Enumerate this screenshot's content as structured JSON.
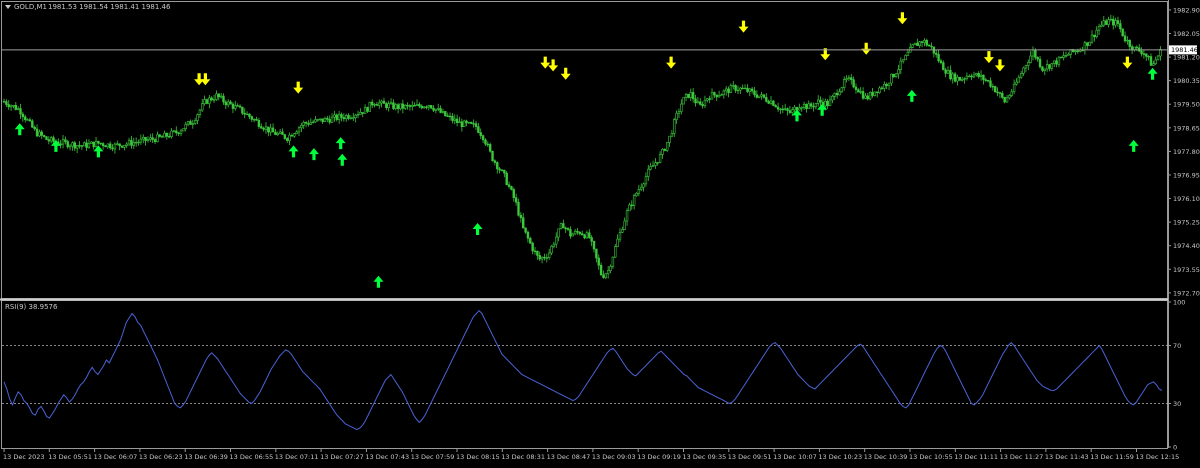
{
  "window": {
    "symbol_title": "GOLD,M1",
    "ohlc_text": "1981.53 1981.54 1981.41 1981.46",
    "current_price_label": "1981.46"
  },
  "colors": {
    "background": "#000000",
    "candles": "#3cc83c",
    "buy_arrow": "#00ff3c",
    "sell_arrow": "#ffff00",
    "rsi_line": "#4a63d6",
    "axis_text": "#c8c8c8",
    "level_line": "#b4b4b4"
  },
  "chart_data": [
    {
      "type": "candlestick",
      "title": "GOLD,M1",
      "y_ticks": [
        "1982.90",
        "1982.05",
        "1981.20",
        "1980.35",
        "1979.50",
        "1978.65",
        "1977.80",
        "1976.95",
        "1976.10",
        "1975.25",
        "1974.40",
        "1973.55",
        "1972.70"
      ],
      "ylim": [
        1972.55,
        1983.15
      ],
      "current_price": 1981.46,
      "series_path": [
        [
          0,
          1979.6
        ],
        [
          10,
          1979.3
        ],
        [
          20,
          1978.5
        ],
        [
          28,
          1978.2
        ],
        [
          38,
          1978.1
        ],
        [
          50,
          1978.0
        ],
        [
          60,
          1978.1
        ],
        [
          70,
          1978.0
        ],
        [
          80,
          1978.1
        ],
        [
          90,
          1978.2
        ],
        [
          100,
          1978.3
        ],
        [
          110,
          1978.5
        ],
        [
          120,
          1978.9
        ],
        [
          128,
          1979.6
        ],
        [
          135,
          1979.8
        ],
        [
          140,
          1979.6
        ],
        [
          150,
          1979.3
        ],
        [
          160,
          1978.9
        ],
        [
          170,
          1978.5
        ],
        [
          180,
          1978.3
        ],
        [
          190,
          1978.8
        ],
        [
          200,
          1978.9
        ],
        [
          210,
          1979.0
        ],
        [
          220,
          1979.1
        ],
        [
          230,
          1979.3
        ],
        [
          235,
          1979.6
        ],
        [
          240,
          1979.5
        ],
        [
          250,
          1979.4
        ],
        [
          260,
          1979.4
        ],
        [
          270,
          1979.5
        ],
        [
          280,
          1979.1
        ],
        [
          290,
          1978.8
        ],
        [
          300,
          1978.7
        ],
        [
          305,
          1978.3
        ],
        [
          310,
          1977.6
        ],
        [
          318,
          1976.9
        ],
        [
          325,
          1976.0
        ],
        [
          330,
          1975.0
        ],
        [
          336,
          1974.3
        ],
        [
          340,
          1973.9
        ],
        [
          346,
          1974.1
        ],
        [
          350,
          1974.6
        ],
        [
          355,
          1975.2
        ],
        [
          360,
          1974.8
        ],
        [
          366,
          1974.9
        ],
        [
          372,
          1974.7
        ],
        [
          376,
          1974.0
        ],
        [
          380,
          1973.3
        ],
        [
          384,
          1973.5
        ],
        [
          390,
          1974.6
        ],
        [
          396,
          1975.6
        ],
        [
          402,
          1976.3
        ],
        [
          410,
          1977.1
        ],
        [
          418,
          1977.7
        ],
        [
          423,
          1978.3
        ],
        [
          427,
          1979.0
        ],
        [
          431,
          1979.6
        ],
        [
          436,
          1979.9
        ],
        [
          442,
          1979.4
        ],
        [
          448,
          1979.8
        ],
        [
          456,
          1979.9
        ],
        [
          464,
          1980.1
        ],
        [
          472,
          1980.0
        ],
        [
          480,
          1979.8
        ],
        [
          488,
          1979.6
        ],
        [
          494,
          1979.3
        ],
        [
          500,
          1979.2
        ],
        [
          506,
          1979.5
        ],
        [
          512,
          1979.4
        ],
        [
          518,
          1979.6
        ],
        [
          524,
          1979.5
        ],
        [
          530,
          1980.0
        ],
        [
          536,
          1980.4
        ],
        [
          542,
          1980.1
        ],
        [
          548,
          1979.7
        ],
        [
          554,
          1980.0
        ],
        [
          560,
          1980.2
        ],
        [
          566,
          1980.6
        ],
        [
          572,
          1981.1
        ],
        [
          578,
          1981.6
        ],
        [
          584,
          1981.8
        ],
        [
          590,
          1981.5
        ],
        [
          596,
          1980.9
        ],
        [
          602,
          1980.5
        ],
        [
          608,
          1980.4
        ],
        [
          614,
          1980.6
        ],
        [
          620,
          1980.5
        ],
        [
          626,
          1980.3
        ],
        [
          632,
          1979.9
        ],
        [
          636,
          1979.6
        ],
        [
          642,
          1980.1
        ],
        [
          648,
          1980.8
        ],
        [
          654,
          1981.4
        ],
        [
          660,
          1980.8
        ],
        [
          668,
          1981.0
        ],
        [
          676,
          1981.3
        ],
        [
          684,
          1981.5
        ],
        [
          690,
          1981.8
        ],
        [
          696,
          1982.3
        ],
        [
          702,
          1982.5
        ],
        [
          708,
          1982.4
        ],
        [
          712,
          1981.9
        ],
        [
          718,
          1981.5
        ],
        [
          724,
          1981.4
        ],
        [
          730,
          1980.9
        ],
        [
          736,
          1981.5
        ]
      ],
      "sell_arrows": [
        [
          124,
          1980.4
        ],
        [
          128,
          1980.4
        ],
        [
          187,
          1980.1
        ],
        [
          344,
          1981.0
        ],
        [
          349,
          1980.9
        ],
        [
          357,
          1980.6
        ],
        [
          424,
          1981.0
        ],
        [
          470,
          1982.3
        ],
        [
          522,
          1981.3
        ],
        [
          548,
          1981.5
        ],
        [
          571,
          1982.6
        ],
        [
          626,
          1981.2
        ],
        [
          633,
          1980.9
        ],
        [
          714,
          1981.0
        ]
      ],
      "buy_arrows": [
        [
          10,
          1978.6
        ],
        [
          33,
          1978.0
        ],
        [
          60,
          1977.8
        ],
        [
          184,
          1977.8
        ],
        [
          238,
          1973.1
        ],
        [
          301,
          1975.0
        ],
        [
          504,
          1979.1
        ],
        [
          520,
          1979.3
        ],
        [
          577,
          1979.8
        ],
        [
          730,
          1980.6
        ],
        [
          718,
          1978.0
        ],
        [
          214,
          1978.1
        ],
        [
          215,
          1977.5
        ],
        [
          197,
          1977.7
        ]
      ],
      "text_labels": []
    },
    {
      "type": "line",
      "title": "RSI(9) 38.9576",
      "series": [
        {
          "name": "RSI(9)",
          "last": 38.9576,
          "values": [
            45,
            40,
            33,
            29,
            34,
            38,
            36,
            32,
            30,
            27,
            23,
            22,
            26,
            28,
            25,
            21,
            20,
            23,
            26,
            30,
            33,
            36,
            34,
            31,
            33,
            36,
            40,
            43,
            45,
            48,
            52,
            55,
            52,
            50,
            53,
            56,
            60,
            58,
            62,
            66,
            70,
            74,
            80,
            86,
            89,
            92,
            90,
            86,
            84,
            80,
            76,
            72,
            68,
            64,
            60,
            55,
            50,
            45,
            40,
            35,
            30,
            28,
            27,
            29,
            32,
            36,
            40,
            44,
            48,
            52,
            56,
            60,
            63,
            65,
            63,
            61,
            58,
            55,
            52,
            49,
            46,
            43,
            40,
            37,
            35,
            33,
            31,
            30,
            32,
            35,
            38,
            42,
            46,
            50,
            54,
            57,
            60,
            63,
            65,
            67,
            66,
            64,
            61,
            58,
            55,
            52,
            50,
            48,
            46,
            44,
            42,
            40,
            37,
            34,
            31,
            28,
            25,
            22,
            20,
            18,
            16,
            15,
            14,
            13,
            12,
            13,
            15,
            18,
            22,
            26,
            30,
            34,
            38,
            42,
            46,
            48,
            50,
            47,
            44,
            41,
            38,
            34,
            30,
            26,
            22,
            19,
            17,
            19,
            22,
            26,
            30,
            34,
            38,
            42,
            46,
            50,
            54,
            58,
            62,
            66,
            70,
            74,
            78,
            82,
            86,
            90,
            92,
            94,
            92,
            88,
            84,
            80,
            76,
            72,
            68,
            64,
            62,
            60,
            58,
            56,
            54,
            52,
            50,
            49,
            48,
            47,
            46,
            45,
            44,
            43,
            42,
            41,
            40,
            39,
            38,
            37,
            36,
            35,
            34,
            33,
            32,
            33,
            35,
            38,
            41,
            44,
            47,
            50,
            53,
            56,
            59,
            62,
            65,
            67,
            68,
            66,
            63,
            60,
            57,
            54,
            52,
            50,
            49,
            51,
            53,
            55,
            57,
            59,
            61,
            63,
            65,
            66,
            64,
            62,
            60,
            58,
            56,
            54,
            52,
            50,
            49,
            47,
            45,
            43,
            41,
            40,
            39,
            38,
            37,
            36,
            35,
            34,
            33,
            32,
            31,
            30,
            31,
            33,
            36,
            39,
            42,
            45,
            48,
            51,
            54,
            57,
            60,
            63,
            66,
            69,
            71,
            72,
            70,
            68,
            65,
            62,
            59,
            56,
            53,
            50,
            48,
            46,
            44,
            42,
            41,
            40,
            42,
            44,
            46,
            48,
            50,
            52,
            54,
            56,
            58,
            60,
            62,
            64,
            66,
            68,
            70,
            71,
            69,
            66,
            63,
            60,
            57,
            54,
            51,
            48,
            45,
            42,
            39,
            36,
            33,
            30,
            28,
            27,
            29,
            33,
            37,
            41,
            45,
            49,
            53,
            57,
            61,
            65,
            68,
            70,
            69,
            66,
            62,
            58,
            54,
            50,
            46,
            42,
            38,
            34,
            30,
            29,
            31,
            33,
            36,
            40,
            44,
            48,
            52,
            56,
            60,
            64,
            67,
            70,
            72,
            70,
            67,
            64,
            61,
            58,
            55,
            52,
            49,
            46,
            44,
            42,
            41,
            40,
            39,
            39,
            40,
            42,
            44,
            46,
            48,
            50,
            52,
            54,
            56,
            58,
            60,
            62,
            64,
            66,
            68,
            70,
            67,
            63,
            59,
            55,
            51,
            47,
            43,
            39,
            35,
            32,
            30,
            29,
            31,
            34,
            37,
            40,
            43,
            44,
            45,
            43,
            40,
            39
          ]
        }
      ],
      "ylim": [
        0,
        100
      ],
      "y_ticks": [
        "100",
        "70",
        "30",
        "0"
      ],
      "levels": [
        70,
        30
      ],
      "x_tick_labels": [
        "13 Dec 2023",
        "13 Dec 05:51",
        "13 Dec 06:07",
        "13 Dec 06:23",
        "13 Dec 06:39",
        "13 Dec 06:55",
        "13 Dec 07:11",
        "13 Dec 07:27",
        "13 Dec 07:43",
        "13 Dec 07:59",
        "13 Dec 08:15",
        "13 Dec 08:31",
        "13 Dec 08:47",
        "13 Dec 09:03",
        "13 Dec 09:19",
        "13 Dec 09:35",
        "13 Dec 09:51",
        "13 Dec 10:07",
        "13 Dec 10:23",
        "13 Dec 10:39",
        "13 Dec 10:55",
        "13 Dec 11:11",
        "13 Dec 11:27",
        "13 Dec 11:43",
        "13 Dec 11:59",
        "13 Dec 12:15"
      ]
    }
  ]
}
